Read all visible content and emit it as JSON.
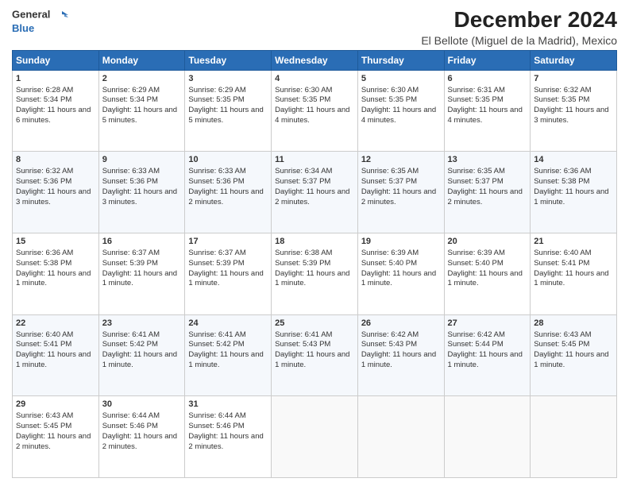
{
  "logo": {
    "line1": "General",
    "line2": "Blue"
  },
  "header": {
    "title": "December 2024",
    "subtitle": "El Bellote (Miguel de la Madrid), Mexico"
  },
  "calendar": {
    "days": [
      "Sunday",
      "Monday",
      "Tuesday",
      "Wednesday",
      "Thursday",
      "Friday",
      "Saturday"
    ],
    "weeks": [
      [
        {
          "day": "1",
          "sunrise": "6:28 AM",
          "sunset": "5:34 PM",
          "daylight": "11 hours and 6 minutes."
        },
        {
          "day": "2",
          "sunrise": "6:29 AM",
          "sunset": "5:34 PM",
          "daylight": "11 hours and 5 minutes."
        },
        {
          "day": "3",
          "sunrise": "6:29 AM",
          "sunset": "5:35 PM",
          "daylight": "11 hours and 5 minutes."
        },
        {
          "day": "4",
          "sunrise": "6:30 AM",
          "sunset": "5:35 PM",
          "daylight": "11 hours and 4 minutes."
        },
        {
          "day": "5",
          "sunrise": "6:30 AM",
          "sunset": "5:35 PM",
          "daylight": "11 hours and 4 minutes."
        },
        {
          "day": "6",
          "sunrise": "6:31 AM",
          "sunset": "5:35 PM",
          "daylight": "11 hours and 4 minutes."
        },
        {
          "day": "7",
          "sunrise": "6:32 AM",
          "sunset": "5:35 PM",
          "daylight": "11 hours and 3 minutes."
        }
      ],
      [
        {
          "day": "8",
          "sunrise": "6:32 AM",
          "sunset": "5:36 PM",
          "daylight": "11 hours and 3 minutes."
        },
        {
          "day": "9",
          "sunrise": "6:33 AM",
          "sunset": "5:36 PM",
          "daylight": "11 hours and 3 minutes."
        },
        {
          "day": "10",
          "sunrise": "6:33 AM",
          "sunset": "5:36 PM",
          "daylight": "11 hours and 2 minutes."
        },
        {
          "day": "11",
          "sunrise": "6:34 AM",
          "sunset": "5:37 PM",
          "daylight": "11 hours and 2 minutes."
        },
        {
          "day": "12",
          "sunrise": "6:35 AM",
          "sunset": "5:37 PM",
          "daylight": "11 hours and 2 minutes."
        },
        {
          "day": "13",
          "sunrise": "6:35 AM",
          "sunset": "5:37 PM",
          "daylight": "11 hours and 2 minutes."
        },
        {
          "day": "14",
          "sunrise": "6:36 AM",
          "sunset": "5:38 PM",
          "daylight": "11 hours and 1 minute."
        }
      ],
      [
        {
          "day": "15",
          "sunrise": "6:36 AM",
          "sunset": "5:38 PM",
          "daylight": "11 hours and 1 minute."
        },
        {
          "day": "16",
          "sunrise": "6:37 AM",
          "sunset": "5:39 PM",
          "daylight": "11 hours and 1 minute."
        },
        {
          "day": "17",
          "sunrise": "6:37 AM",
          "sunset": "5:39 PM",
          "daylight": "11 hours and 1 minute."
        },
        {
          "day": "18",
          "sunrise": "6:38 AM",
          "sunset": "5:39 PM",
          "daylight": "11 hours and 1 minute."
        },
        {
          "day": "19",
          "sunrise": "6:39 AM",
          "sunset": "5:40 PM",
          "daylight": "11 hours and 1 minute."
        },
        {
          "day": "20",
          "sunrise": "6:39 AM",
          "sunset": "5:40 PM",
          "daylight": "11 hours and 1 minute."
        },
        {
          "day": "21",
          "sunrise": "6:40 AM",
          "sunset": "5:41 PM",
          "daylight": "11 hours and 1 minute."
        }
      ],
      [
        {
          "day": "22",
          "sunrise": "6:40 AM",
          "sunset": "5:41 PM",
          "daylight": "11 hours and 1 minute."
        },
        {
          "day": "23",
          "sunrise": "6:41 AM",
          "sunset": "5:42 PM",
          "daylight": "11 hours and 1 minute."
        },
        {
          "day": "24",
          "sunrise": "6:41 AM",
          "sunset": "5:42 PM",
          "daylight": "11 hours and 1 minute."
        },
        {
          "day": "25",
          "sunrise": "6:41 AM",
          "sunset": "5:43 PM",
          "daylight": "11 hours and 1 minute."
        },
        {
          "day": "26",
          "sunrise": "6:42 AM",
          "sunset": "5:43 PM",
          "daylight": "11 hours and 1 minute."
        },
        {
          "day": "27",
          "sunrise": "6:42 AM",
          "sunset": "5:44 PM",
          "daylight": "11 hours and 1 minute."
        },
        {
          "day": "28",
          "sunrise": "6:43 AM",
          "sunset": "5:45 PM",
          "daylight": "11 hours and 1 minute."
        }
      ],
      [
        {
          "day": "29",
          "sunrise": "6:43 AM",
          "sunset": "5:45 PM",
          "daylight": "11 hours and 2 minutes."
        },
        {
          "day": "30",
          "sunrise": "6:44 AM",
          "sunset": "5:46 PM",
          "daylight": "11 hours and 2 minutes."
        },
        {
          "day": "31",
          "sunrise": "6:44 AM",
          "sunset": "5:46 PM",
          "daylight": "11 hours and 2 minutes."
        },
        null,
        null,
        null,
        null
      ]
    ]
  }
}
